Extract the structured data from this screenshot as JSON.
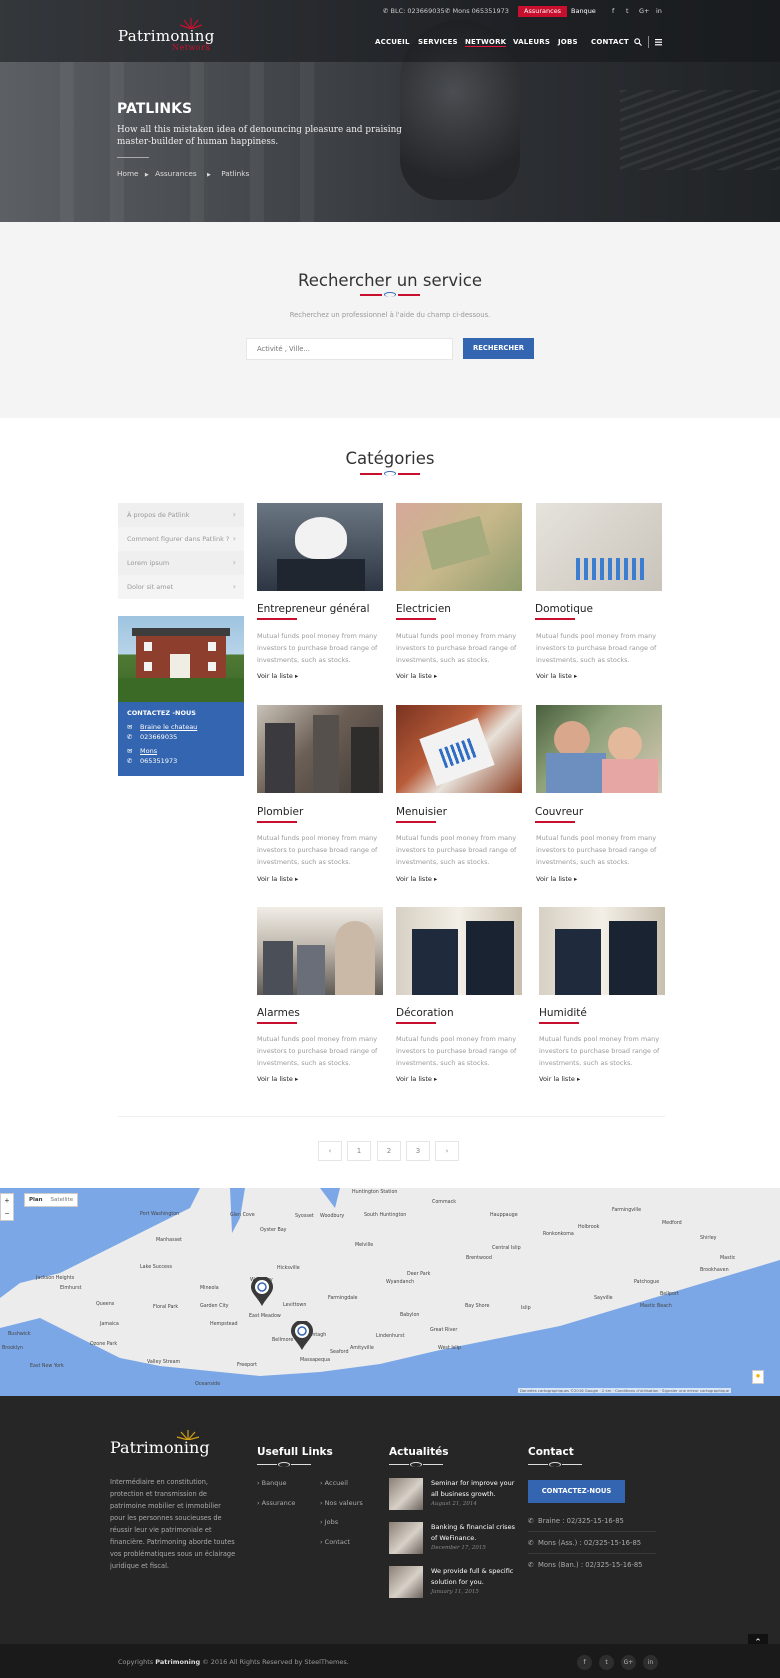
{
  "topbar": {
    "phone_blc": "BLC: 023669035",
    "phone_mons": "Mons 065351973",
    "btn_assurances": "Assurances",
    "btn_banque": "Banque",
    "social": [
      "f",
      "t",
      "G+",
      "in"
    ]
  },
  "logo": {
    "main": "Patrimoning",
    "sub": "Network"
  },
  "nav": {
    "items": [
      "ACCUEIL",
      "SERVICES",
      "NETWORK",
      "VALEURS",
      "JOBS",
      "CONTACT"
    ],
    "active": "NETWORK"
  },
  "hero": {
    "title": "PATLINKS",
    "subtitle_line1": "How all this mistaken idea of denouncing pleasure and praising",
    "subtitle_line2": "master-builder of human happiness.",
    "breadcrumb": [
      "Home",
      "Assurances",
      "Patlinks"
    ]
  },
  "search": {
    "title": "Rechercher un service",
    "description": "Recherchez un professionnel à l'aide du champ ci-dessous.",
    "placeholder": "Activité , Ville...",
    "button": "RECHERCHER"
  },
  "categories": {
    "title": "Catégories",
    "sidebar": [
      "À propos de Patlink",
      "Comment figurer dans Patlink ?",
      "Lorem ipsum",
      "Dolor sit amet"
    ],
    "contact_box": {
      "heading": "CONTACTEZ -NOUS",
      "loc1": "Braine le chateau",
      "phone1": "023669035",
      "loc2": "Mons",
      "phone2": "065351973"
    },
    "cards": [
      {
        "title": "Entrepreneur général",
        "desc": [
          "Mutual funds pool money from many",
          "investors to purchase broad range of",
          "investments, such as stocks."
        ],
        "link": "Voir la liste"
      },
      {
        "title": "Electricien",
        "desc": [
          "Mutual funds pool money from many",
          "investors to purchase broad range of",
          "investments, such as stocks."
        ],
        "link": "Voir la liste"
      },
      {
        "title": "Domotique",
        "desc": [
          "Mutual funds pool money from many",
          "investors to purchase broad range of",
          "investments, such as stocks."
        ],
        "link": "Voir la liste"
      },
      {
        "title": "Plombier",
        "desc": [
          "Mutual funds pool money from many",
          "investors to purchase broad range of",
          "investments, such as stocks."
        ],
        "link": "Voir la liste"
      },
      {
        "title": "Menuisier",
        "desc": [
          "Mutual funds pool money from many",
          "investors to purchase broad range of",
          "investments, such as stocks."
        ],
        "link": "Voir la liste"
      },
      {
        "title": "Couvreur",
        "desc": [
          "Mutual funds pool money from many",
          "investors to purchase broad range of",
          "investments, such as stocks."
        ],
        "link": "Voir la liste"
      },
      {
        "title": "Alarmes",
        "desc": [
          "Mutual funds pool money from many",
          "investors to purchase broad range of",
          "investments, such as stocks."
        ],
        "link": "Voir la liste"
      },
      {
        "title": "Décoration",
        "desc": [
          "Mutual funds pool money from many",
          "investors to purchase broad range of",
          "investments, such as stocks."
        ],
        "link": "Voir la liste"
      },
      {
        "title": "Humidité",
        "desc": [
          "Mutual funds pool money from many",
          "investors to purchase broad range of",
          "investments, such as stocks."
        ],
        "link": "Voir la liste"
      }
    ]
  },
  "pagination": [
    "‹",
    "1",
    "2",
    "3",
    "›"
  ],
  "map": {
    "tabs": [
      "Plan",
      "Satellite"
    ],
    "zoom": [
      "+",
      "−"
    ],
    "towns": [
      "Huntington Station",
      "Commack",
      "Hauppauge",
      "Farmingville",
      "Medford",
      "Syosset",
      "Woodbury",
      "South Huntington",
      "Ronkonkoma",
      "Holbrook",
      "Shirley",
      "Mastic",
      "Melville",
      "Central Islip",
      "Brentwood",
      "Bay Shore",
      "Islip",
      "Sayville",
      "Patchogue",
      "Hicksville",
      "Deer Park",
      "Wyandanch",
      "Levittown",
      "Farmingdale",
      "Babylon",
      "Lindenhurst",
      "Amityville",
      "Freeport",
      "Oceanside",
      "Valley Stream",
      "Hempstead",
      "Garden City",
      "Floral Park",
      "Mineola",
      "Lake Success",
      "Westbury",
      "East Meadow",
      "Wantagh",
      "Bellmore",
      "Queens",
      "Jamaica",
      "Manhasset",
      "Glen Cove",
      "Oyster Bay",
      "Port Washington",
      "Brookhaven",
      "Bellport",
      "Mastic Beach",
      "Great River",
      "West Islip",
      "Seaford",
      "Massapequa",
      "Jackson Heights",
      "Bushwick",
      "Elmhurst",
      "East New York",
      "Brooklyn",
      "Ozone Park"
    ],
    "footer_text": "Données cartographiques ©2016 Google · 2 km · Conditions d'utilisation · Signaler une erreur cartographique"
  },
  "footer": {
    "logo": "Patrimoning",
    "about": [
      "Intermédiaire en constitution,",
      "protection et transmission de",
      "patrimoine mobilier et immobilier",
      "pour les personnes soucieuses de",
      "réussir leur vie patrimoniale et",
      "financière. Patrimoning aborde toutes",
      "vos problématiques sous un éclairage",
      "juridique et fiscal."
    ],
    "links_title": "Usefull Links",
    "links_col1": [
      "Banque",
      "Assurance"
    ],
    "links_col2": [
      "Accueil",
      "Nos valeurs",
      "Jobs",
      "Contact"
    ],
    "news_title": "Actualités",
    "news": [
      {
        "title1": "Seminar for improve your",
        "title2": "all business growth.",
        "date": "August 21, 2014"
      },
      {
        "title1": "Banking & financial crises",
        "title2": "of WeFinance.",
        "date": "December 17, 2015"
      },
      {
        "title1": "We provide full & specific",
        "title2": "solution for you.",
        "date": "January 11, 2015"
      }
    ],
    "contact_title": "Contact",
    "contact_btn": "CONTACTEZ-NOUS",
    "phones": [
      "Braine : 02/325-15-16-85",
      "Mons (Ass.) : 02/325-15-16-85",
      "Mons (Ban.) : 02/325-15-16-85"
    ]
  },
  "bottom": {
    "copy_pre": "Copyrights",
    "copy_brand": "Patrimoning",
    "copy_post": "© 2016 All Rights Reserved by SteelThemes.",
    "social": [
      "f",
      "t",
      "G+",
      "in"
    ]
  },
  "colors": {
    "accent_red": "#c8102e",
    "accent_blue": "#3465b0",
    "footer_bg": "#262626"
  }
}
